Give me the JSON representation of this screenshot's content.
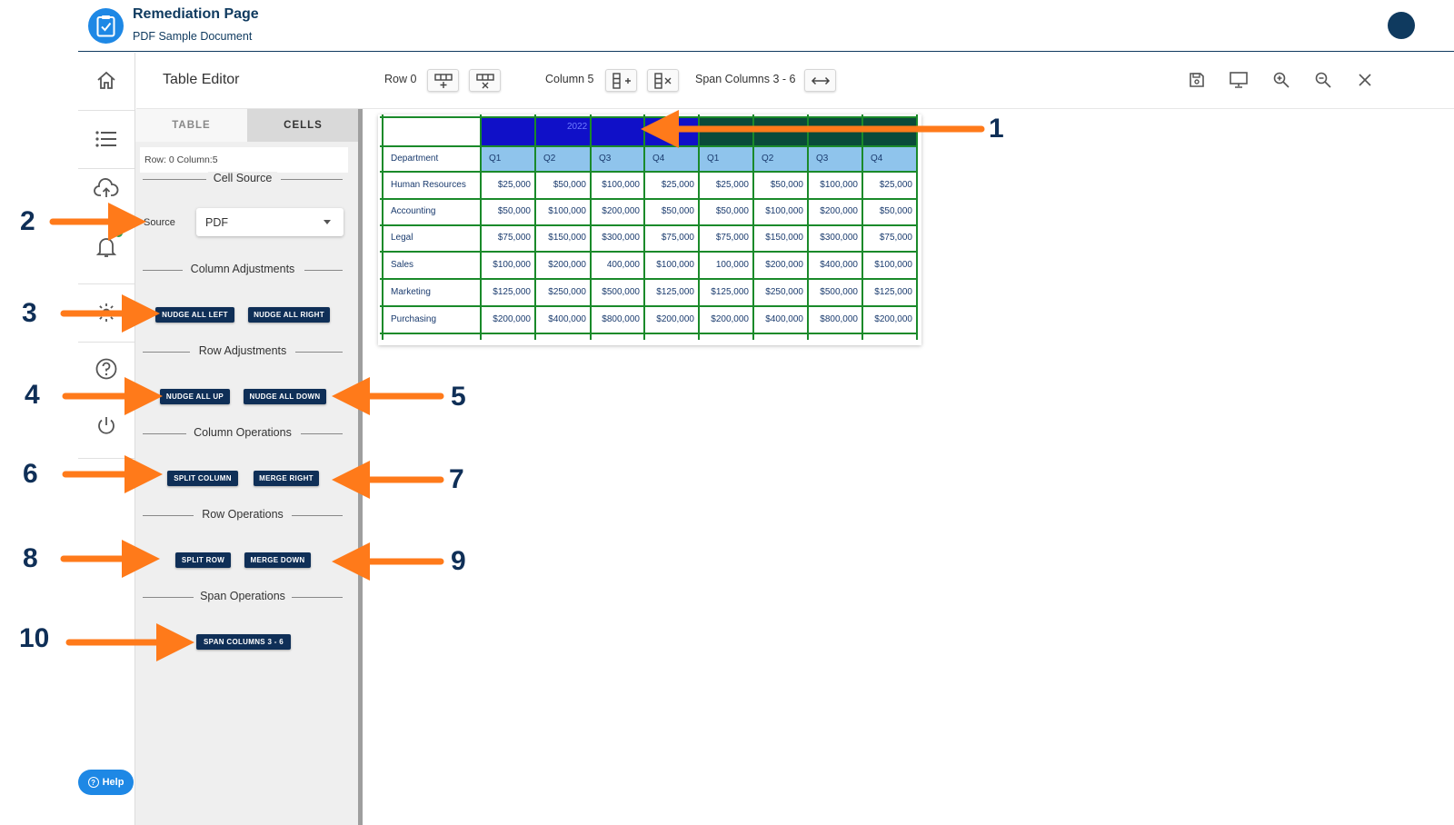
{
  "header": {
    "title": "Remediation Page",
    "subtitle": "PDF Sample Document"
  },
  "nav": {
    "items": [
      "home-icon",
      "list-icon",
      "cloud-upload-icon",
      "bell-icon",
      "gear-icon",
      "help-circle-icon",
      "power-icon"
    ],
    "help_label": "Help"
  },
  "toolbar": {
    "title": "Table Editor",
    "row_label": "Row 0",
    "column_label": "Column 5",
    "span_label": "Span Columns 3 - 6"
  },
  "panel": {
    "tabs": [
      {
        "label": "TABLE"
      },
      {
        "label": "CELLS"
      }
    ],
    "row_col_info": "Row: 0 Column:5",
    "cell_source_heading": "Cell Source",
    "source_label": "Source",
    "source_value": "PDF",
    "column_adjustments_heading": "Column Adjustments",
    "nudge_all_left": "NUDGE ALL LEFT",
    "nudge_all_right": "NUDGE ALL RIGHT",
    "row_adjustments_heading": "Row Adjustments",
    "nudge_all_up": "NUDGE ALL UP",
    "nudge_all_down": "NUDGE ALL DOWN",
    "column_operations_heading": "Column Operations",
    "split_column": "SPLIT COLUMN",
    "merge_right": "MERGE RIGHT",
    "row_operations_heading": "Row Operations",
    "split_row": "SPLIT ROW",
    "merge_down": "MERGE DOWN",
    "span_operations_heading": "Span Operations",
    "span_columns": "SPAN COLUMNS 3 - 6"
  },
  "table": {
    "year_label": "2022",
    "headers": [
      "Department",
      "Q1",
      "Q2",
      "Q3",
      "Q4",
      "Q1",
      "Q2",
      "Q3",
      "Q4"
    ],
    "rows": [
      [
        "Human Resources",
        "$25,000",
        "$50,000",
        "$100,000",
        "$25,000",
        "$25,000",
        "$50,000",
        "$100,000",
        "$25,000"
      ],
      [
        "Accounting",
        "$50,000",
        "$100,000",
        "$200,000",
        "$50,000",
        "$50,000",
        "$100,000",
        "$200,000",
        "$50,000"
      ],
      [
        "Legal",
        "$75,000",
        "$150,000",
        "$300,000",
        "$75,000",
        "$75,000",
        "$150,000",
        "$300,000",
        "$75,000"
      ],
      [
        "Sales",
        "$100,000",
        "$200,000",
        "400,000",
        "$100,000",
        "100,000",
        "$200,000",
        "$400,000",
        "$100,000"
      ],
      [
        "Marketing",
        "$125,000",
        "$250,000",
        "$500,000",
        "$125,000",
        "$125,000",
        "$250,000",
        "$500,000",
        "$125,000"
      ],
      [
        "Purchasing",
        "$200,000",
        "$400,000",
        "$800,000",
        "$200,000",
        "$200,000",
        "$400,000",
        "$800,000",
        "$200,000"
      ]
    ],
    "colors": {
      "year_band": "#1010c8",
      "year_band_right": "#0a4a3a",
      "header_row": "#8fc4ec",
      "grid": "#1a8a2a"
    }
  },
  "annotations": [
    "1",
    "2",
    "3",
    "4",
    "5",
    "6",
    "7",
    "8",
    "9",
    "10"
  ],
  "colors": {
    "accent": "#1e88e5",
    "navy": "#0f2f57",
    "arrow": "#ff7a1a"
  }
}
